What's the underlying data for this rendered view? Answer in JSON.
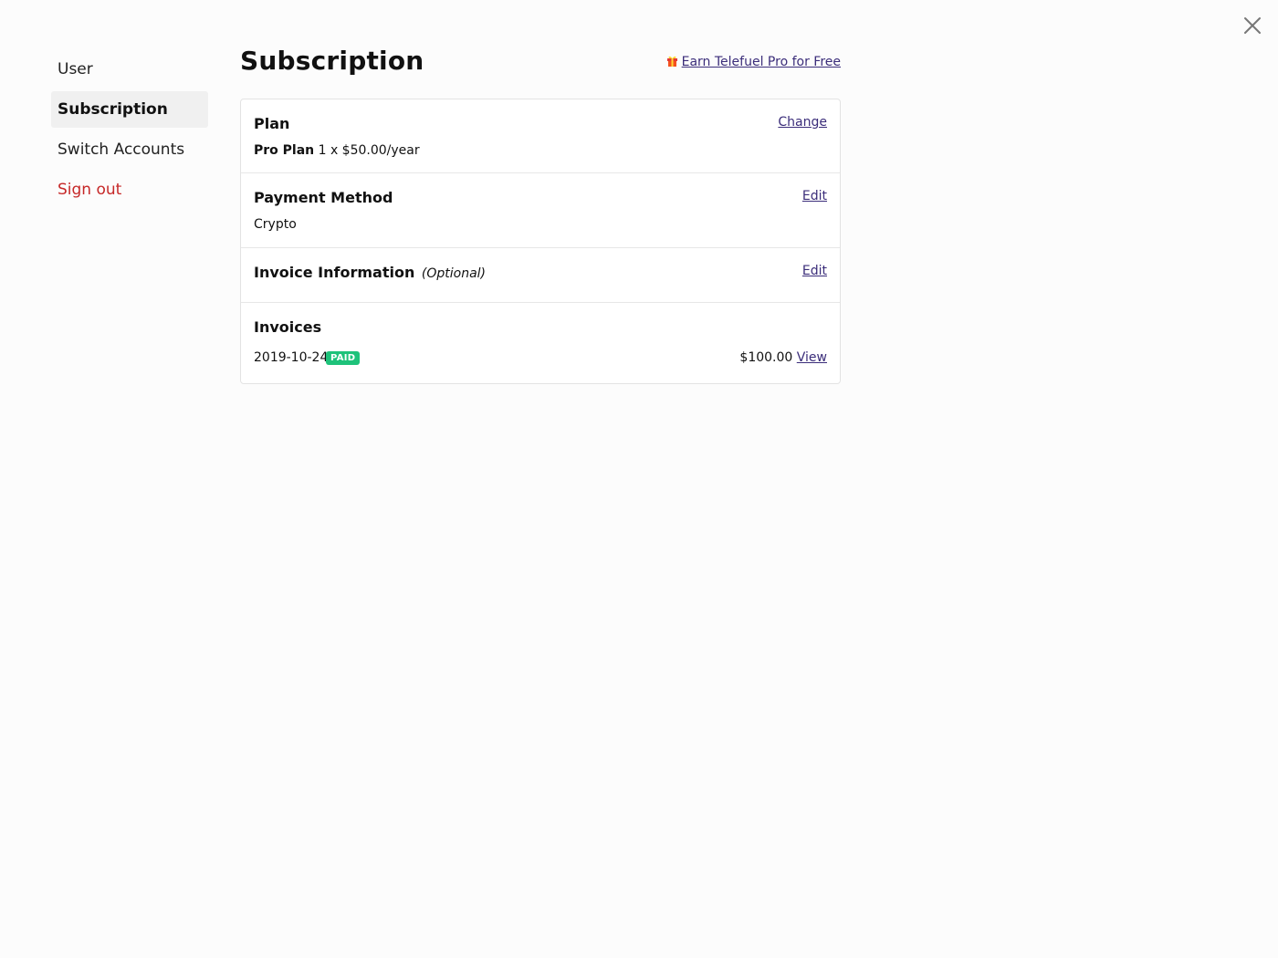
{
  "close": {
    "icon": "close-icon"
  },
  "sidebar": {
    "items": [
      {
        "label": "User"
      },
      {
        "label": "Subscription"
      },
      {
        "label": "Switch Accounts"
      },
      {
        "label": "Sign out"
      }
    ],
    "active_index": 1
  },
  "header": {
    "title": "Subscription",
    "promo_link": "Earn Telefuel Pro for Free",
    "promo_icon": "gift-icon"
  },
  "plan": {
    "title": "Plan",
    "action": "Change",
    "name": "Pro Plan",
    "detail": "1 x $50.00/year"
  },
  "payment": {
    "title": "Payment Method",
    "action": "Edit",
    "value": "Crypto"
  },
  "invoice_info": {
    "title": "Invoice Information",
    "optional": "(Optional)",
    "action": "Edit"
  },
  "invoices": {
    "title": "Invoices",
    "rows": [
      {
        "date": "2019-10-24",
        "status": "PAID",
        "amount": "$100.00",
        "action": "View"
      }
    ]
  },
  "colors": {
    "link": "#3b2d7a",
    "danger": "#c62828",
    "paid_badge": "#1ec27a",
    "active_bg": "#f0f0f0"
  }
}
